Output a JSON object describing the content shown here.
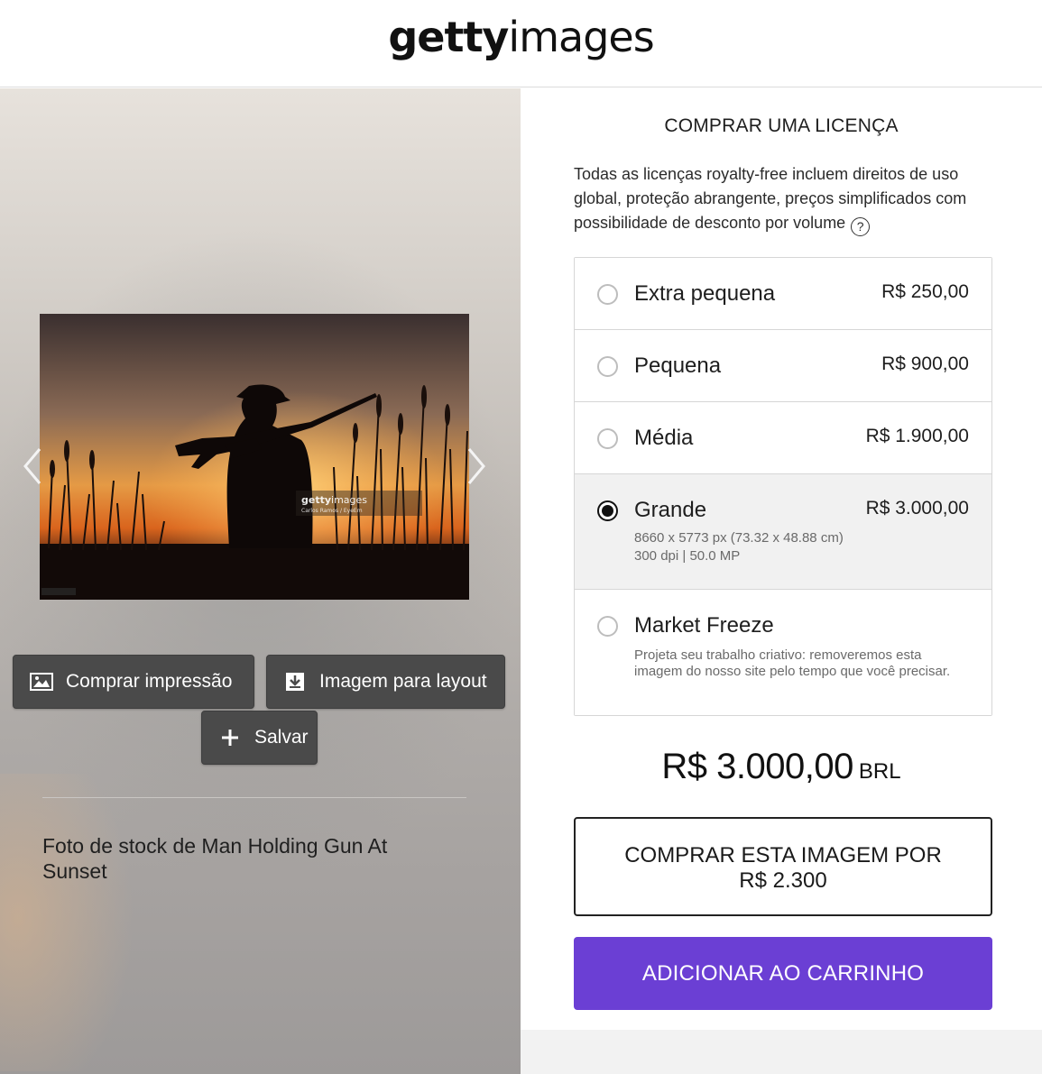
{
  "header": {
    "logo_bold": "getty",
    "logo_light": "images"
  },
  "preview": {
    "watermark_bold": "getty",
    "watermark_light": "images",
    "watermark_credit": "Carlos Ramos / EyeEm",
    "prev_icon": "chevron-left-icon",
    "next_icon": "chevron-right-icon"
  },
  "actions": {
    "print_label": "Comprar impressão",
    "layout_label": "Imagem para layout",
    "save_label": "Salvar"
  },
  "caption": "Foto de stock de Man Holding Gun At Sunset",
  "license": {
    "title": "COMPRAR UMA LICENÇA",
    "description": "Todas as licenças royalty-free incluem direitos de uso global, proteção abrangente, preços simplificados com possibilidade de desconto por volume",
    "help_icon": "?",
    "options": [
      {
        "name": "Extra pequena",
        "price": "R$ 250,00",
        "selected": false
      },
      {
        "name": "Pequena",
        "price": "R$ 900,00",
        "selected": false
      },
      {
        "name": "Média",
        "price": "R$ 1.900,00",
        "selected": false
      },
      {
        "name": "Grande",
        "price": "R$ 3.000,00",
        "selected": true,
        "detail_1": "8660 x 5773 px (73.32 x 48.88 cm)",
        "detail_2": "300 dpi | 50.0 MP"
      },
      {
        "name": "Market Freeze",
        "price": "",
        "selected": false,
        "detail": "Projeta seu trabalho criativo: removeremos esta imagem do nosso site pelo tempo que você precisar."
      }
    ],
    "total_amount": "R$ 3.000,00",
    "total_currency": "BRL",
    "buy_label_1": "COMPRAR ESTA IMAGEM POR",
    "buy_label_2": "R$ 2.300",
    "cart_label": "ADICIONAR AO CARRINHO",
    "accent_color": "#6b3fd4"
  }
}
